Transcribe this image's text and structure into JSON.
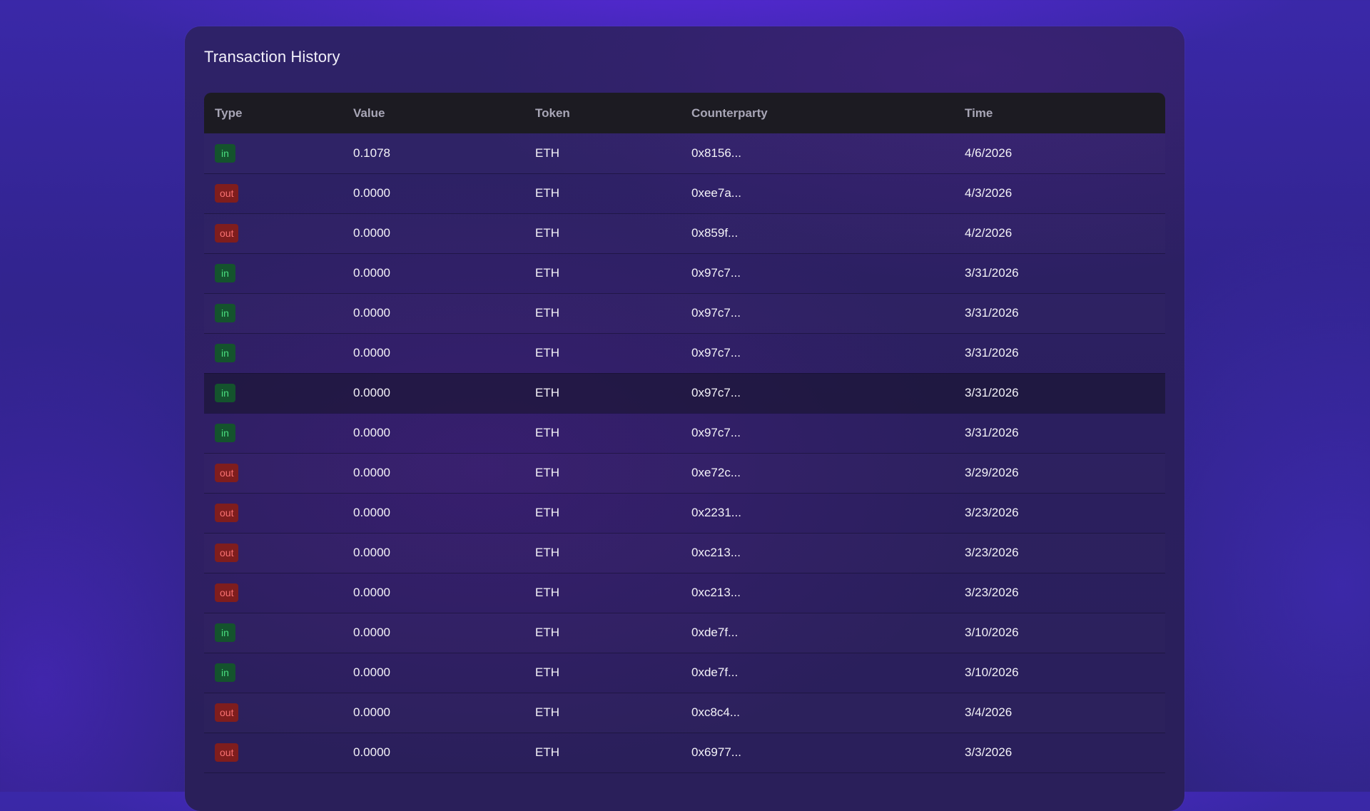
{
  "card": {
    "title": "Transaction History"
  },
  "table": {
    "columns": [
      "Type",
      "Value",
      "Token",
      "Counterparty",
      "Time"
    ],
    "rows": [
      {
        "type": "in",
        "value": "0.1078",
        "token": "ETH",
        "counterparty": "0x8156...",
        "time": "4/6/2026"
      },
      {
        "type": "out",
        "value": "0.0000",
        "token": "ETH",
        "counterparty": "0xee7a...",
        "time": "4/3/2026"
      },
      {
        "type": "out",
        "value": "0.0000",
        "token": "ETH",
        "counterparty": "0x859f...",
        "time": "4/2/2026"
      },
      {
        "type": "in",
        "value": "0.0000",
        "token": "ETH",
        "counterparty": "0x97c7...",
        "time": "3/31/2026"
      },
      {
        "type": "in",
        "value": "0.0000",
        "token": "ETH",
        "counterparty": "0x97c7...",
        "time": "3/31/2026"
      },
      {
        "type": "in",
        "value": "0.0000",
        "token": "ETH",
        "counterparty": "0x97c7...",
        "time": "3/31/2026"
      },
      {
        "type": "in",
        "value": "0.0000",
        "token": "ETH",
        "counterparty": "0x97c7...",
        "time": "3/31/2026"
      },
      {
        "type": "in",
        "value": "0.0000",
        "token": "ETH",
        "counterparty": "0x97c7...",
        "time": "3/31/2026"
      },
      {
        "type": "out",
        "value": "0.0000",
        "token": "ETH",
        "counterparty": "0xe72c...",
        "time": "3/29/2026"
      },
      {
        "type": "out",
        "value": "0.0000",
        "token": "ETH",
        "counterparty": "0x2231...",
        "time": "3/23/2026"
      },
      {
        "type": "out",
        "value": "0.0000",
        "token": "ETH",
        "counterparty": "0xc213...",
        "time": "3/23/2026"
      },
      {
        "type": "out",
        "value": "0.0000",
        "token": "ETH",
        "counterparty": "0xc213...",
        "time": "3/23/2026"
      },
      {
        "type": "in",
        "value": "0.0000",
        "token": "ETH",
        "counterparty": "0xde7f...",
        "time": "3/10/2026"
      },
      {
        "type": "in",
        "value": "0.0000",
        "token": "ETH",
        "counterparty": "0xde7f...",
        "time": "3/10/2026"
      },
      {
        "type": "out",
        "value": "0.0000",
        "token": "ETH",
        "counterparty": "0xc8c4...",
        "time": "3/4/2026"
      },
      {
        "type": "out",
        "value": "0.0000",
        "token": "ETH",
        "counterparty": "0x6977...",
        "time": "3/3/2026"
      }
    ]
  },
  "colors": {
    "in_badge_bg": "#14532d",
    "in_badge_text": "#4ade80",
    "out_badge_bg": "#7f1d1d",
    "out_badge_text": "#f87171",
    "header_bg": "#1c1b22"
  }
}
